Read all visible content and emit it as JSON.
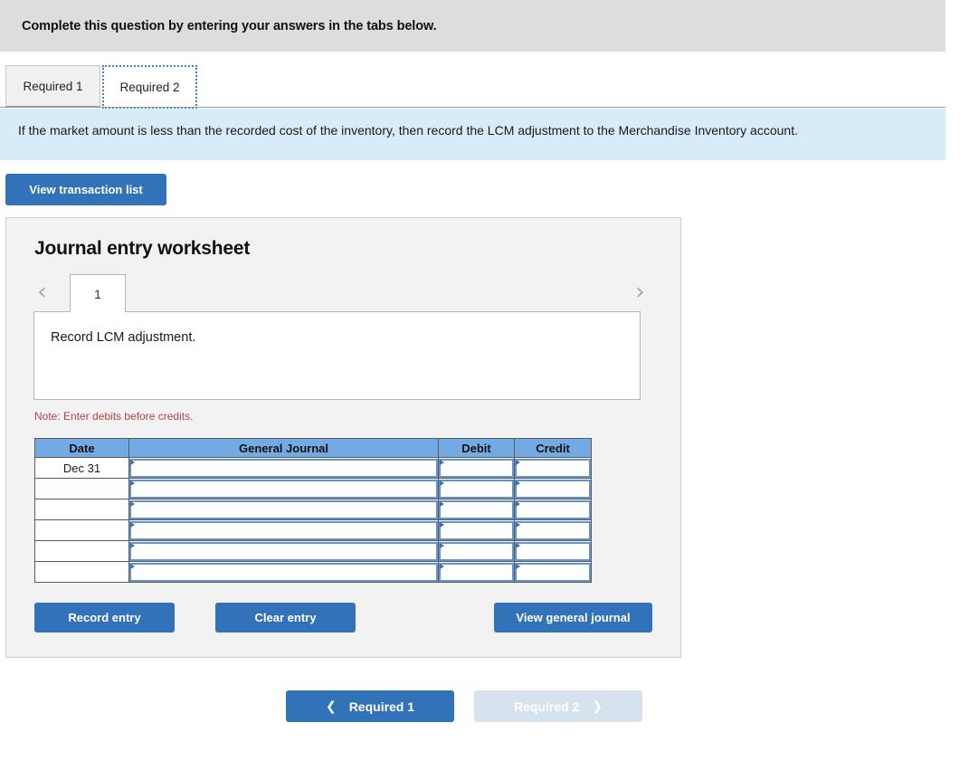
{
  "instruction": {
    "text": "Complete this question by entering your answers in the tabs below."
  },
  "tabs": [
    {
      "label": "Required 1",
      "active": false
    },
    {
      "label": "Required 2",
      "active": true
    }
  ],
  "info_banner": {
    "text": "If the market amount is less than the recorded cost of the inventory, then record the LCM adjustment to the Merchandise Inventory account."
  },
  "toolbar": {
    "view_transaction_list_label": "View transaction list"
  },
  "worksheet": {
    "title": "Journal entry worksheet",
    "pager": {
      "prev_icon": "chevron-left-icon",
      "next_icon": "chevron-right-icon",
      "entries": [
        "1"
      ],
      "active_entry": "1"
    },
    "description": "Record LCM adjustment.",
    "note": "Note: Enter debits before credits.",
    "table": {
      "headers": [
        "Date",
        "General Journal",
        "Debit",
        "Credit"
      ],
      "rows": [
        {
          "date": "Dec 31",
          "general_journal": "",
          "debit": "",
          "credit": ""
        },
        {
          "date": "",
          "general_journal": "",
          "debit": "",
          "credit": ""
        },
        {
          "date": "",
          "general_journal": "",
          "debit": "",
          "credit": ""
        },
        {
          "date": "",
          "general_journal": "",
          "debit": "",
          "credit": ""
        },
        {
          "date": "",
          "general_journal": "",
          "debit": "",
          "credit": ""
        },
        {
          "date": "",
          "general_journal": "",
          "debit": "",
          "credit": ""
        }
      ]
    },
    "buttons": {
      "record_entry": "Record entry",
      "clear_entry": "Clear entry",
      "view_general_journal": "View general journal"
    }
  },
  "bottom_nav": {
    "prev_label": "Required 1",
    "next_label": "Required 2",
    "prev_icon": "chevron-left-icon",
    "next_icon": "chevron-right-icon",
    "next_disabled": true
  },
  "colors": {
    "primary_blue": "#3272b8",
    "table_header_blue": "#74aae4",
    "info_banner_blue": "#d7ebf8",
    "instruction_gray": "#dddddd",
    "panel_gray": "#f2f2f2",
    "note_red": "#b3434a",
    "disabled_blue": "#d6e2ee"
  }
}
